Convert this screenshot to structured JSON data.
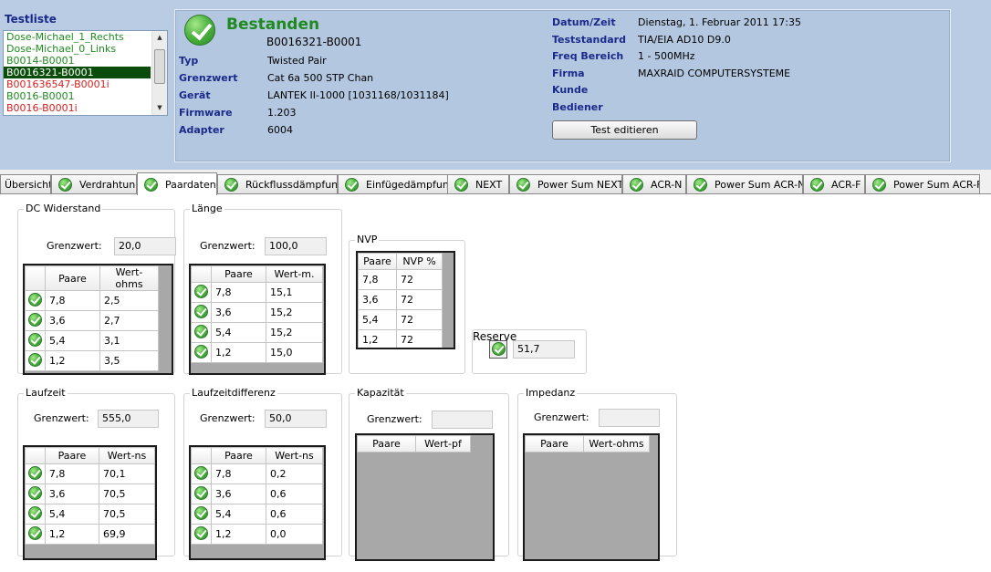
{
  "testlist": {
    "title": "Testliste",
    "items": [
      {
        "label": "Dose-Michael_1_Rechts",
        "color": "#1f8a1f",
        "selected": false
      },
      {
        "label": "Dose-Michael_0_Links",
        "color": "#1f8a1f",
        "selected": false
      },
      {
        "label": "B0014-B0001",
        "color": "#1f8a1f",
        "selected": false
      },
      {
        "label": "B0016321-B0001",
        "color": "#ffffff",
        "selected": true
      },
      {
        "label": "B001636547-B0001i",
        "color": "#d42020",
        "selected": false
      },
      {
        "label": "B0016-B0001",
        "color": "#1f8a1f",
        "selected": false
      },
      {
        "label": "B0016-B0001i",
        "color": "#d42020",
        "selected": false
      }
    ]
  },
  "header": {
    "status": "Bestanden",
    "test_id": "B0016321-B0001",
    "left_fields": [
      {
        "label": "Typ",
        "value": "Twisted Pair"
      },
      {
        "label": "Grenzwert",
        "value": "Cat 6a 500 STP Chan"
      },
      {
        "label": "Gerät",
        "value": "LANTEK II-1000 [1031168/1031184]"
      },
      {
        "label": "Firmware",
        "value": "1.203"
      },
      {
        "label": "Adapter",
        "value": "6004"
      }
    ],
    "right_fields": [
      {
        "label": "Datum/Zeit",
        "value": "Dienstag, 1. Februar 2011 17:35"
      },
      {
        "label": "Teststandard",
        "value": "TIA/EIA AD10 D9.0"
      },
      {
        "label": "Freq Bereich",
        "value": "1 - 500MHz"
      },
      {
        "label": "Firma",
        "value": "MAXRAID COMPUTERSYSTEME"
      },
      {
        "label": "Kunde",
        "value": ""
      },
      {
        "label": "Bediener",
        "value": ""
      }
    ],
    "edit_button": "Test editieren"
  },
  "tabs": [
    {
      "label": "Übersicht",
      "icon": false,
      "active": false
    },
    {
      "label": "Verdrahtung",
      "icon": true,
      "active": false
    },
    {
      "label": "Paardaten",
      "icon": true,
      "active": true
    },
    {
      "label": "Rückflussdämpfung",
      "icon": true,
      "active": false
    },
    {
      "label": "Einfügedämpfung",
      "icon": true,
      "active": false
    },
    {
      "label": "NEXT",
      "icon": true,
      "active": false
    },
    {
      "label": "Power Sum NEXT",
      "icon": true,
      "active": false
    },
    {
      "label": "ACR-N",
      "icon": true,
      "active": false
    },
    {
      "label": "Power Sum ACR-N",
      "icon": true,
      "active": false
    },
    {
      "label": "ACR-F",
      "icon": true,
      "active": false
    },
    {
      "label": "Power Sum ACR-F",
      "icon": true,
      "active": false
    }
  ],
  "groups": {
    "dc": {
      "title": "DC Widerstand",
      "limit_label": "Grenzwert:",
      "limit": "20,0",
      "cols": [
        "Paare",
        "Wert-ohms"
      ],
      "rows": [
        [
          "7,8",
          "2,5"
        ],
        [
          "3,6",
          "2,7"
        ],
        [
          "5,4",
          "3,1"
        ],
        [
          "1,2",
          "3,5"
        ]
      ]
    },
    "laenge": {
      "title": "Länge",
      "limit_label": "Grenzwert:",
      "limit": "100,0",
      "cols": [
        "Paare",
        "Wert-m."
      ],
      "rows": [
        [
          "7,8",
          "15,1"
        ],
        [
          "3,6",
          "15,2"
        ],
        [
          "5,4",
          "15,2"
        ],
        [
          "1,2",
          "15,0"
        ]
      ]
    },
    "nvp": {
      "title": "NVP",
      "cols": [
        "Paare",
        "NVP %"
      ],
      "rows": [
        [
          "7,8",
          "72"
        ],
        [
          "3,6",
          "72"
        ],
        [
          "5,4",
          "72"
        ],
        [
          "1,2",
          "72"
        ]
      ]
    },
    "reserve": {
      "title": "Reserve",
      "value": "51,7"
    },
    "laufzeit": {
      "title": "Laufzeit",
      "limit_label": "Grenzwert:",
      "limit": "555,0",
      "cols": [
        "Paare",
        "Wert-ns"
      ],
      "rows": [
        [
          "7,8",
          "70,1"
        ],
        [
          "3,6",
          "70,5"
        ],
        [
          "5,4",
          "70,5"
        ],
        [
          "1,2",
          "69,9"
        ]
      ]
    },
    "laufzeitdiff": {
      "title": "Laufzeitdifferenz",
      "limit_label": "Grenzwert:",
      "limit": "50,0",
      "cols": [
        "Paare",
        "Wert-ns"
      ],
      "rows": [
        [
          "7,8",
          "0,2"
        ],
        [
          "3,6",
          "0,6"
        ],
        [
          "5,4",
          "0,6"
        ],
        [
          "1,2",
          "0,0"
        ]
      ]
    },
    "kapazitaet": {
      "title": "Kapazität",
      "limit_label": "Grenzwert:",
      "limit": "",
      "cols": [
        "Paare",
        "Wert-pf"
      ],
      "rows": []
    },
    "impedanz": {
      "title": "Impedanz",
      "limit_label": "Grenzwert:",
      "limit": "",
      "cols": [
        "Paare",
        "Wert-ohms"
      ],
      "rows": []
    }
  }
}
